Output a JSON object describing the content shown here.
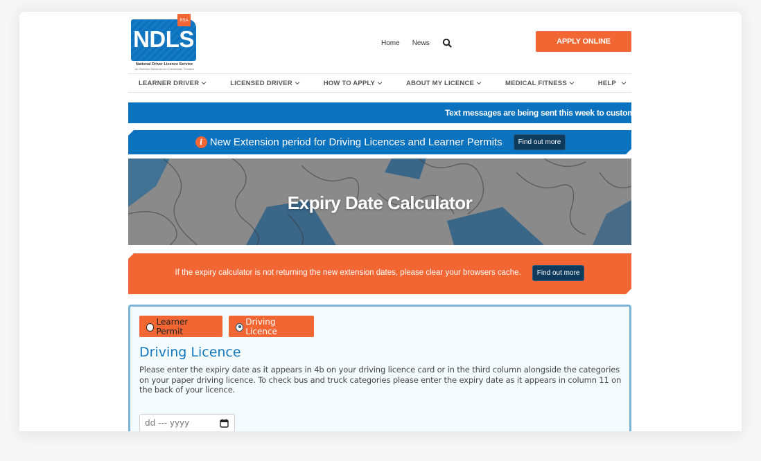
{
  "logo": {
    "brand": "NDLS",
    "badge": "RSA",
    "subtitle": "National Driver Licence Service",
    "subtitle_irish": "An tSeirbhís Náisiúnta um Cheadúnais Tiomána"
  },
  "header": {
    "links": [
      {
        "label": "Home"
      },
      {
        "label": "News"
      }
    ],
    "search_icon": "search-icon",
    "apply_label": "APPLY ONLINE"
  },
  "nav": {
    "items": [
      {
        "label": "LEARNER DRIVER"
      },
      {
        "label": "LICENSED DRIVER"
      },
      {
        "label": "HOW TO APPLY"
      },
      {
        "label": "ABOUT MY LICENCE"
      },
      {
        "label": "MEDICAL FITNESS"
      },
      {
        "label": "HELP"
      }
    ]
  },
  "ticker": {
    "text": "Text messages are being sent this week to customers"
  },
  "extension_banner": {
    "icon": "info-icon",
    "icon_glyph": "i",
    "text": "New Extension period for Driving Licences and Learner Permits",
    "button_label": "Find out more"
  },
  "hero": {
    "title": "Expiry Date Calculator"
  },
  "notice": {
    "text": "If the expiry calculator is not returning the new extension dates, please clear your browsers cache.",
    "button_label": "Find out more"
  },
  "calculator": {
    "options": [
      {
        "label": "Learner Permit",
        "selected": false
      },
      {
        "label": "Driving Licence",
        "selected": true
      }
    ],
    "title": "Driving Licence",
    "description": "Please enter the expiry date as it appears in 4b on your driving licence card or in the third column alongside the categories on your paper driving licence. To check bus and truck categories please enter the expiry date as it appears in column 11 on the back of your licence.",
    "date_input": {
      "placeholder": "dd --- yyyy",
      "value": ""
    }
  },
  "colors": {
    "brand_blue": "#0a72be",
    "brand_orange": "#f26633",
    "dark_button": "#0e3a5c",
    "panel_border": "#7ab3d4",
    "title_blue": "#1478bc"
  }
}
